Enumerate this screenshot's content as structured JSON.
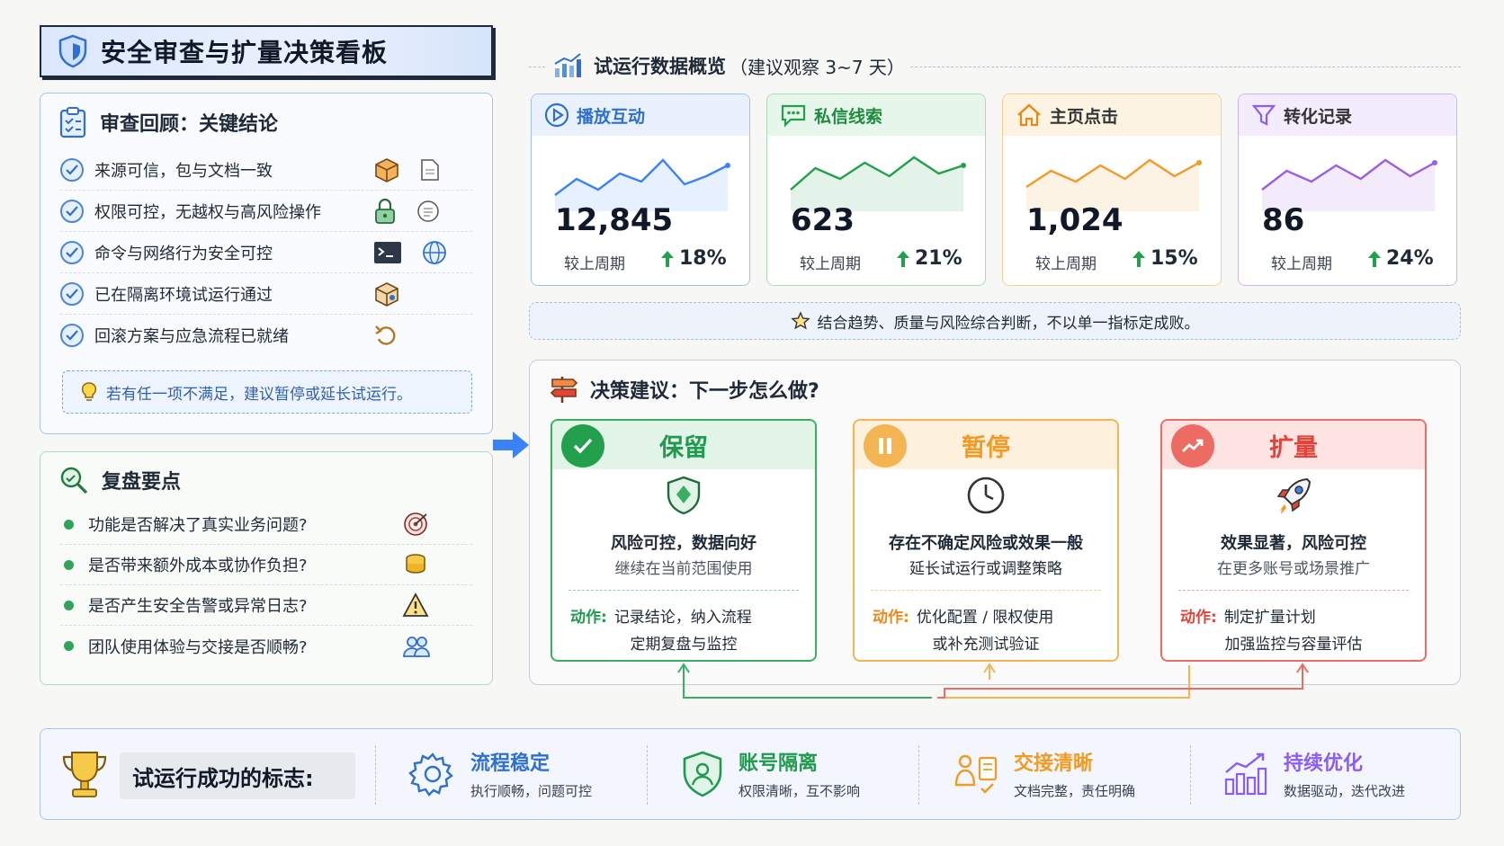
{
  "title": "安全审查与扩量决策看板",
  "review": {
    "heading": "审查回顾：关键结论",
    "items": [
      {
        "text": "来源可信，包与文档一致",
        "icons": [
          "package-icon",
          "document-icon"
        ]
      },
      {
        "text": "权限可控，无越权与高风险操作",
        "icons": [
          "lock-icon",
          "note-icon"
        ]
      },
      {
        "text": "命令与网络行为安全可控",
        "icons": [
          "terminal-icon",
          "globe-icon"
        ]
      },
      {
        "text": "已在隔离环境试运行通过",
        "icons": [
          "sandbox-box-icon"
        ]
      },
      {
        "text": "回滚方案与应急流程已就绪",
        "icons": [
          "undo-icon"
        ]
      }
    ],
    "note": "若有任一项不满足，建议暂停或延长试运行。"
  },
  "recap": {
    "heading": "复盘要点",
    "items": [
      {
        "text": "功能是否解决了真实业务问题?",
        "icon": "target-icon"
      },
      {
        "text": "是否带来额外成本或协作负担?",
        "icon": "coins-icon"
      },
      {
        "text": "是否产生安全告警或异常日志?",
        "icon": "warning-icon"
      },
      {
        "text": "团队使用体验与交接是否顺畅?",
        "icon": "team-icon"
      }
    ]
  },
  "overview": {
    "heading": "试运行数据概览",
    "subheading": "（建议观察 3~7 天）",
    "cards": [
      {
        "title": "播放互动",
        "value": "12,845",
        "compare_label": "较上周期",
        "change": "18%",
        "color": "#3b82f6",
        "icon": "play-icon",
        "trend": [
          0.2,
          0.5,
          0.3,
          0.6,
          0.45,
          0.85,
          0.4,
          0.55,
          0.75
        ]
      },
      {
        "title": "私信线索",
        "value": "623",
        "compare_label": "较上周期",
        "change": "21%",
        "color": "#22a04b",
        "icon": "chat-icon",
        "trend": [
          0.3,
          0.7,
          0.5,
          0.8,
          0.55,
          0.9,
          0.6,
          0.75
        ]
      },
      {
        "title": "主页点击",
        "value": "1,024",
        "compare_label": "较上周期",
        "change": "15%",
        "color": "#f29a23",
        "icon": "home-icon",
        "trend": [
          0.35,
          0.65,
          0.45,
          0.75,
          0.5,
          0.85,
          0.55,
          0.8
        ]
      },
      {
        "title": "转化记录",
        "value": "86",
        "compare_label": "较上周期",
        "change": "24%",
        "color": "#9b5de5",
        "icon": "funnel-icon",
        "trend": [
          0.3,
          0.65,
          0.45,
          0.75,
          0.5,
          0.85,
          0.55,
          0.8
        ]
      }
    ],
    "tip": "结合趋势、质量与风险综合判断，不以单一指标定成败。"
  },
  "decision": {
    "heading": "决策建议：下一步怎么做?",
    "options": [
      {
        "title": "保留",
        "line1": "风险可控，数据向好",
        "line2": "继续在当前范围使用",
        "action_label": "动作:",
        "action1": "记录结论，纳入流程",
        "action2": "定期复盘与监控",
        "color": "#1f9a4e",
        "head_bg": "#e2f4e7",
        "icon": "shield-icon",
        "badge_icon": "check-icon"
      },
      {
        "title": "暂停",
        "line1": "存在不确定风险或效果一般",
        "line2": "延长试运行或调整策略",
        "action_label": "动作:",
        "action1": "优化配置 / 限权使用",
        "action2": "或补充测试验证",
        "color": "#f29a23",
        "head_bg": "#fdf0dc",
        "icon": "clock-icon",
        "badge_icon": "pause-icon"
      },
      {
        "title": "扩量",
        "line1": "效果显著，风险可控",
        "line2": "在更多账号或场景推广",
        "action_label": "动作:",
        "action1": "制定扩量计划",
        "action2": "加强监控与容量评估",
        "color": "#e0443c",
        "head_bg": "#fde4e2",
        "icon": "rocket-icon",
        "badge_icon": "trend-up-icon"
      }
    ]
  },
  "footer": {
    "label": "试运行成功的标志:",
    "items": [
      {
        "title": "流程稳定",
        "sub": "执行顺畅，问题可控",
        "color": "#2f6fd0",
        "icon": "gear-icon"
      },
      {
        "title": "账号隔离",
        "sub": "权限清晰，互不影响",
        "color": "#1f9a4e",
        "icon": "user-shield-icon"
      },
      {
        "title": "交接清晰",
        "sub": "文档完整，责任明确",
        "color": "#f29a23",
        "icon": "handover-icon"
      },
      {
        "title": "持续优化",
        "sub": "数据驱动，迭代改进",
        "color": "#8b5cf6",
        "icon": "growth-chart-icon"
      }
    ]
  }
}
